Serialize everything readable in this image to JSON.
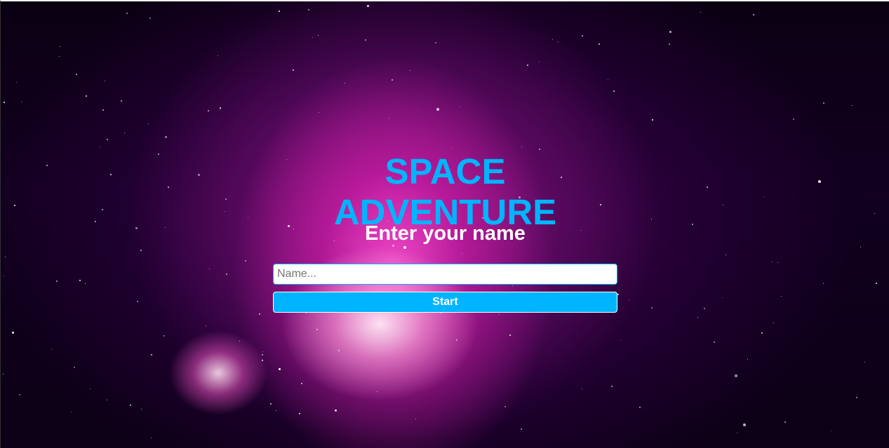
{
  "background": {
    "theme": "nebula",
    "accent_color": "#00b4ff",
    "text_color": "#ffffff"
  },
  "main": {
    "title": "SPACE ADVENTURE",
    "subtitle": "Enter your name",
    "name_input": {
      "value": "",
      "placeholder": "Name..."
    },
    "start_button_label": "Start"
  }
}
